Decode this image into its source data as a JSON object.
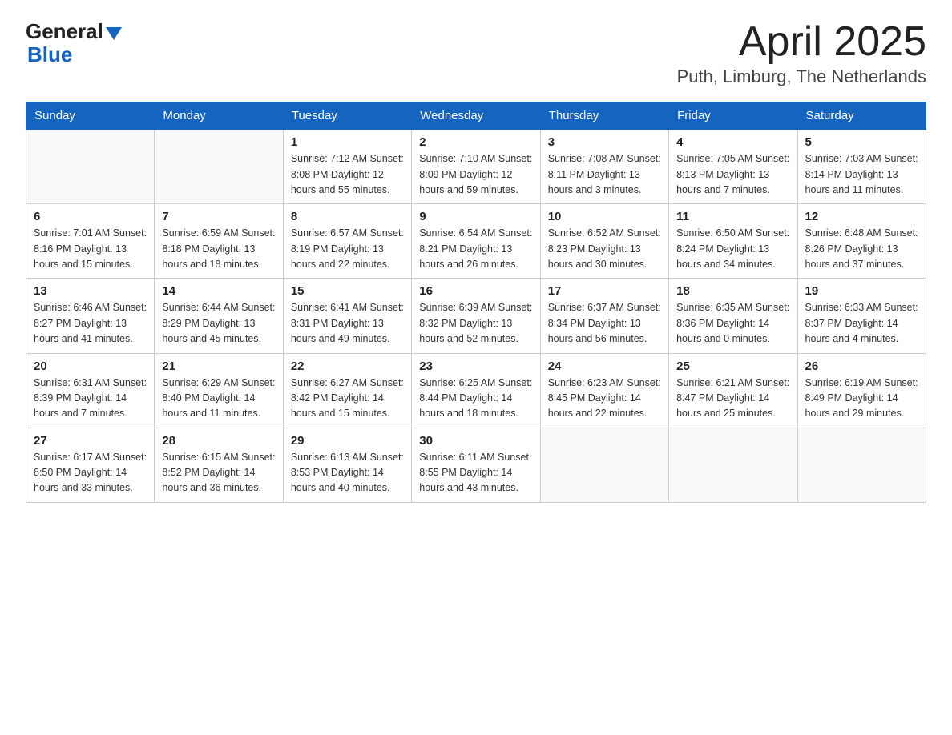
{
  "header": {
    "logo_general": "General",
    "logo_blue": "Blue",
    "title": "April 2025",
    "subtitle": "Puth, Limburg, The Netherlands"
  },
  "calendar": {
    "days_of_week": [
      "Sunday",
      "Monday",
      "Tuesday",
      "Wednesday",
      "Thursday",
      "Friday",
      "Saturday"
    ],
    "weeks": [
      [
        {
          "day": "",
          "info": ""
        },
        {
          "day": "",
          "info": ""
        },
        {
          "day": "1",
          "info": "Sunrise: 7:12 AM\nSunset: 8:08 PM\nDaylight: 12 hours\nand 55 minutes."
        },
        {
          "day": "2",
          "info": "Sunrise: 7:10 AM\nSunset: 8:09 PM\nDaylight: 12 hours\nand 59 minutes."
        },
        {
          "day": "3",
          "info": "Sunrise: 7:08 AM\nSunset: 8:11 PM\nDaylight: 13 hours\nand 3 minutes."
        },
        {
          "day": "4",
          "info": "Sunrise: 7:05 AM\nSunset: 8:13 PM\nDaylight: 13 hours\nand 7 minutes."
        },
        {
          "day": "5",
          "info": "Sunrise: 7:03 AM\nSunset: 8:14 PM\nDaylight: 13 hours\nand 11 minutes."
        }
      ],
      [
        {
          "day": "6",
          "info": "Sunrise: 7:01 AM\nSunset: 8:16 PM\nDaylight: 13 hours\nand 15 minutes."
        },
        {
          "day": "7",
          "info": "Sunrise: 6:59 AM\nSunset: 8:18 PM\nDaylight: 13 hours\nand 18 minutes."
        },
        {
          "day": "8",
          "info": "Sunrise: 6:57 AM\nSunset: 8:19 PM\nDaylight: 13 hours\nand 22 minutes."
        },
        {
          "day": "9",
          "info": "Sunrise: 6:54 AM\nSunset: 8:21 PM\nDaylight: 13 hours\nand 26 minutes."
        },
        {
          "day": "10",
          "info": "Sunrise: 6:52 AM\nSunset: 8:23 PM\nDaylight: 13 hours\nand 30 minutes."
        },
        {
          "day": "11",
          "info": "Sunrise: 6:50 AM\nSunset: 8:24 PM\nDaylight: 13 hours\nand 34 minutes."
        },
        {
          "day": "12",
          "info": "Sunrise: 6:48 AM\nSunset: 8:26 PM\nDaylight: 13 hours\nand 37 minutes."
        }
      ],
      [
        {
          "day": "13",
          "info": "Sunrise: 6:46 AM\nSunset: 8:27 PM\nDaylight: 13 hours\nand 41 minutes."
        },
        {
          "day": "14",
          "info": "Sunrise: 6:44 AM\nSunset: 8:29 PM\nDaylight: 13 hours\nand 45 minutes."
        },
        {
          "day": "15",
          "info": "Sunrise: 6:41 AM\nSunset: 8:31 PM\nDaylight: 13 hours\nand 49 minutes."
        },
        {
          "day": "16",
          "info": "Sunrise: 6:39 AM\nSunset: 8:32 PM\nDaylight: 13 hours\nand 52 minutes."
        },
        {
          "day": "17",
          "info": "Sunrise: 6:37 AM\nSunset: 8:34 PM\nDaylight: 13 hours\nand 56 minutes."
        },
        {
          "day": "18",
          "info": "Sunrise: 6:35 AM\nSunset: 8:36 PM\nDaylight: 14 hours\nand 0 minutes."
        },
        {
          "day": "19",
          "info": "Sunrise: 6:33 AM\nSunset: 8:37 PM\nDaylight: 14 hours\nand 4 minutes."
        }
      ],
      [
        {
          "day": "20",
          "info": "Sunrise: 6:31 AM\nSunset: 8:39 PM\nDaylight: 14 hours\nand 7 minutes."
        },
        {
          "day": "21",
          "info": "Sunrise: 6:29 AM\nSunset: 8:40 PM\nDaylight: 14 hours\nand 11 minutes."
        },
        {
          "day": "22",
          "info": "Sunrise: 6:27 AM\nSunset: 8:42 PM\nDaylight: 14 hours\nand 15 minutes."
        },
        {
          "day": "23",
          "info": "Sunrise: 6:25 AM\nSunset: 8:44 PM\nDaylight: 14 hours\nand 18 minutes."
        },
        {
          "day": "24",
          "info": "Sunrise: 6:23 AM\nSunset: 8:45 PM\nDaylight: 14 hours\nand 22 minutes."
        },
        {
          "day": "25",
          "info": "Sunrise: 6:21 AM\nSunset: 8:47 PM\nDaylight: 14 hours\nand 25 minutes."
        },
        {
          "day": "26",
          "info": "Sunrise: 6:19 AM\nSunset: 8:49 PM\nDaylight: 14 hours\nand 29 minutes."
        }
      ],
      [
        {
          "day": "27",
          "info": "Sunrise: 6:17 AM\nSunset: 8:50 PM\nDaylight: 14 hours\nand 33 minutes."
        },
        {
          "day": "28",
          "info": "Sunrise: 6:15 AM\nSunset: 8:52 PM\nDaylight: 14 hours\nand 36 minutes."
        },
        {
          "day": "29",
          "info": "Sunrise: 6:13 AM\nSunset: 8:53 PM\nDaylight: 14 hours\nand 40 minutes."
        },
        {
          "day": "30",
          "info": "Sunrise: 6:11 AM\nSunset: 8:55 PM\nDaylight: 14 hours\nand 43 minutes."
        },
        {
          "day": "",
          "info": ""
        },
        {
          "day": "",
          "info": ""
        },
        {
          "day": "",
          "info": ""
        }
      ]
    ]
  }
}
